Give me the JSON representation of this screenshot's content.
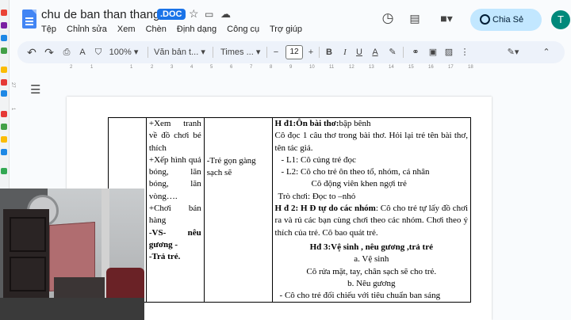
{
  "header": {
    "doc_title": "chu de ban than  thang 10",
    "file_badge": ".DOC",
    "share_label": "Chia Sẻ",
    "avatar_initial": "T"
  },
  "menu": [
    "Tệp",
    "Chỉnh sửa",
    "Xem",
    "Chèn",
    "Định dạng",
    "Công cụ",
    "Trợ giúp"
  ],
  "toolbar": {
    "zoom": "100%",
    "style": "Văn bản t...",
    "font": "Times ...",
    "font_size": "12",
    "minus": "−",
    "plus": "+"
  },
  "ruler": {
    "h": [
      "2",
      "1",
      "1",
      "2",
      "3",
      "4",
      "5",
      "6",
      "7",
      "8",
      "9",
      "10",
      "11",
      "12",
      "13",
      "14",
      "15",
      "16",
      "17",
      "18"
    ],
    "v": [
      "27",
      "1"
    ]
  },
  "table": {
    "col1": [
      "+Xem tranh về đồ chơi bé thích",
      "+Xếp hình quả bóng, lăn bóng, lăn vòng….",
      "+Chơi bán hàng",
      "-VS- nêu gương -",
      "-Trả trẻ."
    ],
    "col2": "-Trẻ gọn gàng sạch sẽ",
    "col3": {
      "h1_bold": "H đ1:Ôn bài thơ:",
      "h1_rest": "bập bênh",
      "p1": "Cô đọc 1 câu thơ trong bài thơ. Hỏi lại trẻ tên bài thơ, tên tác giả.",
      "l1": "-  L1: Cô củng trẻ đọc",
      "l2": "-  L2: Cô cho trẻ ôn theo tổ, nhóm, cá nhân",
      "l3": "Cô động viên khen ngợi trẻ",
      "game": "Trò chơi: Đọc to –nhỏ",
      "h2_bold": "H đ 2: H Đ tự do các nhóm",
      "h2_rest": ": Cô cho trẻ tự lấy đồ chơi ra và rủ các bạn cùng chơi theo các nhóm. Chơi theo ý thích của trẻ. Cô bao quát trẻ.",
      "h3": "Hđ 3:Vệ sinh , nêu gương ,trả trẻ",
      "a": "a. Vệ sinh",
      "a_text": "Cô rửa mặt, tay, chân sạch sẽ cho trẻ.",
      "b": "b. Nêu gương",
      "b_text": "- Cô cho trẻ đối chiếu với tiêu chuẩn ban sáng"
    }
  }
}
